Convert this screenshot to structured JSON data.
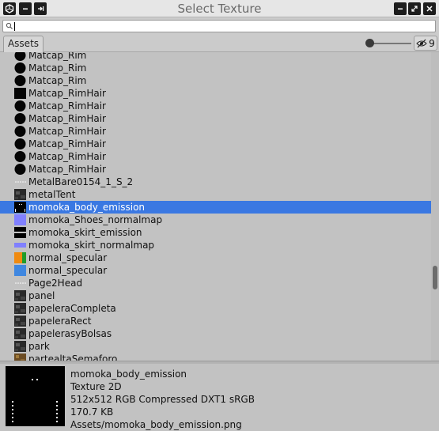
{
  "window": {
    "title": "Select Texture",
    "controls": [
      "unity-logo-icon",
      "minimize-icon",
      "pin-icon",
      "menu-icon",
      "restore-icon",
      "close-icon"
    ]
  },
  "search": {
    "value": "",
    "placeholder": ""
  },
  "tabs": [
    {
      "label": "Assets"
    }
  ],
  "visibility": {
    "hidden_count": "9"
  },
  "items": [
    {
      "name": "Matcap_Rim",
      "thumb": "sphere"
    },
    {
      "name": "Matcap_Rim",
      "thumb": "sphere"
    },
    {
      "name": "Matcap_Rim",
      "thumb": "sphere"
    },
    {
      "name": "Matcap_RimHair",
      "thumb": "black"
    },
    {
      "name": "Matcap_RimHair",
      "thumb": "sphere"
    },
    {
      "name": "Matcap_RimHair",
      "thumb": "sphere"
    },
    {
      "name": "Matcap_RimHair",
      "thumb": "sphere"
    },
    {
      "name": "Matcap_RimHair",
      "thumb": "sphere"
    },
    {
      "name": "Matcap_RimHair",
      "thumb": "sphere"
    },
    {
      "name": "Matcap_RimHair",
      "thumb": "sphere"
    },
    {
      "name": "MetalBare0154_1_S_2",
      "thumb": "dots"
    },
    {
      "name": "metalTent",
      "thumb": "dark-texture"
    },
    {
      "name": "momoka_body_emission",
      "thumb": "emission",
      "selected": true
    },
    {
      "name": "momoka_Shoes_normalmap",
      "thumb": "normal"
    },
    {
      "name": "momoka_skirt_emission",
      "thumb": "skirt-emission"
    },
    {
      "name": "momoka_skirt_normalmap",
      "thumb": "normal-strip"
    },
    {
      "name": "normal_specular",
      "thumb": "orange-green"
    },
    {
      "name": "normal_specular",
      "thumb": "blue"
    },
    {
      "name": "Page2Head",
      "thumb": "dots"
    },
    {
      "name": "panel",
      "thumb": "dark-texture"
    },
    {
      "name": "papeleraCompleta",
      "thumb": "dark-texture"
    },
    {
      "name": "papeleraRect",
      "thumb": "dark-texture"
    },
    {
      "name": "papelerasyBolsas",
      "thumb": "dark-texture"
    },
    {
      "name": "park",
      "thumb": "dark-texture"
    },
    {
      "name": "partealtaSemaforo",
      "thumb": "brown-texture"
    }
  ],
  "selected": {
    "name": "momoka_body_emission",
    "type": "Texture 2D",
    "format": "512x512  RGB Compressed DXT1 sRGB",
    "size": "170.7 KB",
    "path": "Assets/momoka_body_emission.png"
  },
  "colors": {
    "selection": "#3a78e2",
    "background": "#c2c2c2",
    "normalmap": "#8080ff"
  }
}
